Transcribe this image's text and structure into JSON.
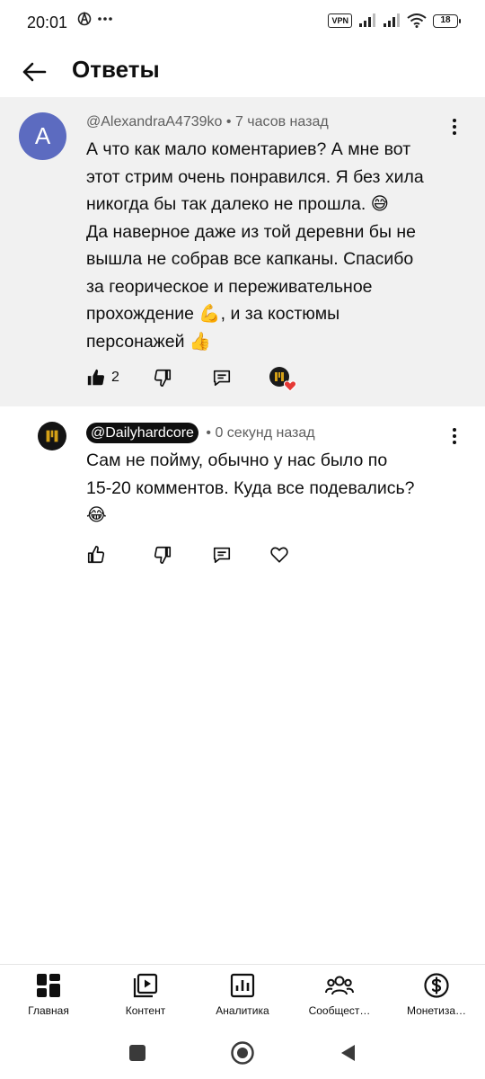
{
  "status_bar": {
    "time": "20:01",
    "vpn": "VPN",
    "battery": "18"
  },
  "header": {
    "title": "Ответы"
  },
  "parent_comment": {
    "avatar_letter": "A",
    "avatar_color": "#5c6bc0",
    "author": "@AlexandraA4739ko",
    "separator": " • ",
    "time_ago": "7 часов назад",
    "lines": [
      "А что как мало коментариев? А мне вот",
      "этот стрим очень понравился. Я без хила",
      "никогда бы так далеко не прошла. 😅",
      "Да наверное даже из той деревни бы не",
      "вышла не собрав все капканы. Спасибо",
      "за георическое и переживательное",
      "прохождение 💪, и за костюмы",
      "персонажей 👍"
    ],
    "likes": "2"
  },
  "reply": {
    "author": "@Dailyhardcore",
    "separator": " • ",
    "time_ago": "0 секунд назад",
    "lines": [
      "Сам не пойму, обычно у нас было по",
      "15-20 комментов. Куда все подевались?",
      "😂"
    ]
  },
  "bottom_nav": [
    {
      "label": "Главная",
      "icon": "dashboard-icon"
    },
    {
      "label": "Контент",
      "icon": "content-icon"
    },
    {
      "label": "Аналитика",
      "icon": "analytics-icon"
    },
    {
      "label": "Сообщест…",
      "icon": "community-icon"
    },
    {
      "label": "Монетиза…",
      "icon": "monetization-icon"
    }
  ]
}
